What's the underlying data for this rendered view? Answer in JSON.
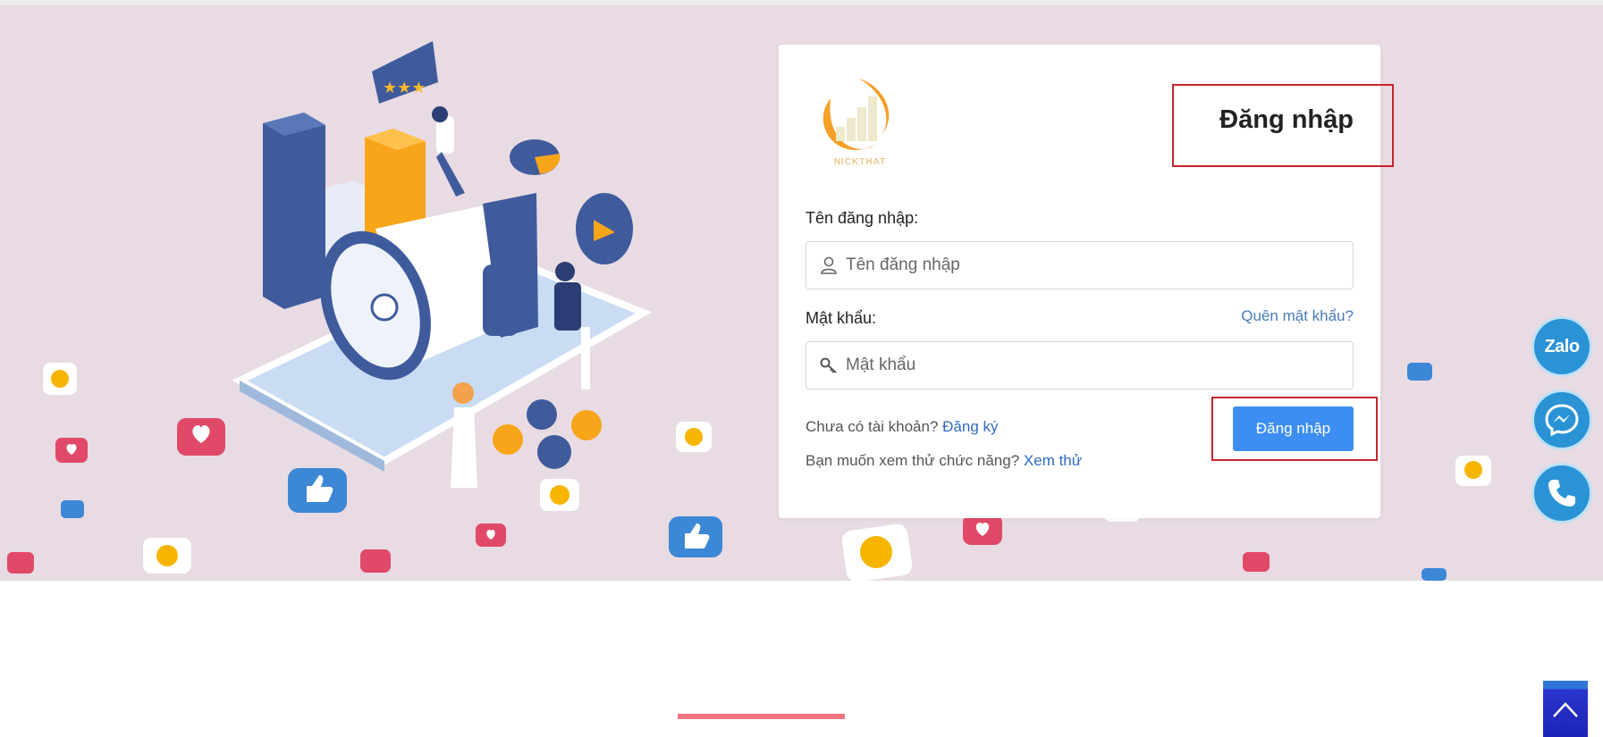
{
  "login": {
    "title": "Đăng nhập",
    "logo_text": "NICKTHAT",
    "username_label": "Tên đăng nhập:",
    "username_placeholder": "Tên đăng nhập",
    "password_label": "Mật khẩu:",
    "password_placeholder": "Mật khẩu",
    "forgot_link": "Quên mật khẩu?",
    "submit_label": "Đăng nhập",
    "no_account_text": "Chưa có tài khoản?",
    "register_link": "Đăng ký",
    "try_text": "Bạn muốn xem thử chức năng?",
    "try_link": "Xem thử"
  },
  "floating": {
    "zalo_label": "Zalo",
    "messenger_icon": "messenger-icon",
    "phone_icon": "phone-icon"
  },
  "colors": {
    "hero_bg": "#e8dbe3",
    "primary_button": "#3d8ef2",
    "link": "#2f6bc0",
    "highlight_box": "#c8232c",
    "fab": "#2a93d5",
    "bottom_accent": "#ef7480"
  }
}
